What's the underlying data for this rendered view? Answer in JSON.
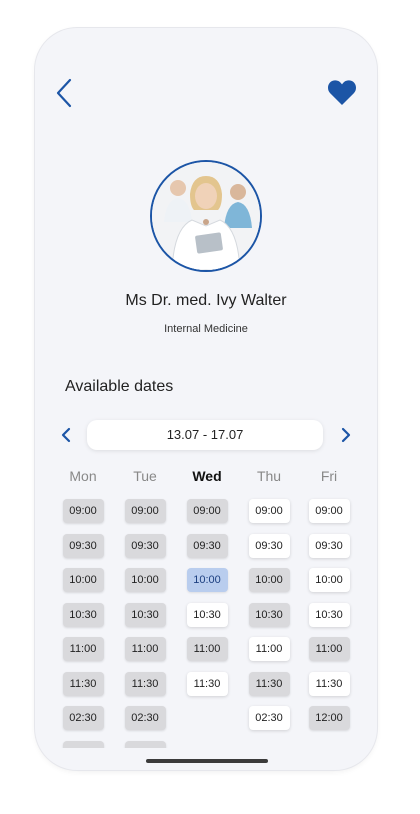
{
  "header": {
    "back_icon": "chevron-left-icon",
    "favorite_icon": "heart-icon",
    "accent_color": "#1c55a6"
  },
  "doctor": {
    "name": "Ms Dr. med. Ivy Walter",
    "specialty": "Internal Medicine"
  },
  "schedule": {
    "title": "Available dates",
    "week_range": "13.07 - 17.07",
    "prev_icon": "chevron-left-icon",
    "next_icon": "chevron-right-icon",
    "days": [
      {
        "label": "Mon",
        "active": false,
        "slots": [
          {
            "time": "09:00",
            "state": "unavailable"
          },
          {
            "time": "09:30",
            "state": "unavailable"
          },
          {
            "time": "10:00",
            "state": "unavailable"
          },
          {
            "time": "10:30",
            "state": "unavailable"
          },
          {
            "time": "11:00",
            "state": "unavailable"
          },
          {
            "time": "11:30",
            "state": "unavailable"
          },
          {
            "time": "02:30",
            "state": "unavailable"
          }
        ]
      },
      {
        "label": "Tue",
        "active": false,
        "slots": [
          {
            "time": "09:00",
            "state": "unavailable"
          },
          {
            "time": "09:30",
            "state": "unavailable"
          },
          {
            "time": "10:00",
            "state": "unavailable"
          },
          {
            "time": "10:30",
            "state": "unavailable"
          },
          {
            "time": "11:00",
            "state": "unavailable"
          },
          {
            "time": "11:30",
            "state": "unavailable"
          },
          {
            "time": "02:30",
            "state": "unavailable"
          }
        ]
      },
      {
        "label": "Wed",
        "active": true,
        "slots": [
          {
            "time": "09:00",
            "state": "unavailable"
          },
          {
            "time": "09:30",
            "state": "unavailable"
          },
          {
            "time": "10:00",
            "state": "selected"
          },
          {
            "time": "10:30",
            "state": "available"
          },
          {
            "time": "11:00",
            "state": "unavailable"
          },
          {
            "time": "11:30",
            "state": "available"
          }
        ]
      },
      {
        "label": "Thu",
        "active": false,
        "slots": [
          {
            "time": "09:00",
            "state": "available"
          },
          {
            "time": "09:30",
            "state": "available"
          },
          {
            "time": "10:00",
            "state": "unavailable"
          },
          {
            "time": "10:30",
            "state": "unavailable"
          },
          {
            "time": "11:00",
            "state": "available"
          },
          {
            "time": "11:30",
            "state": "unavailable"
          },
          {
            "time": "02:30",
            "state": "available"
          }
        ]
      },
      {
        "label": "Fri",
        "active": false,
        "slots": [
          {
            "time": "09:00",
            "state": "available"
          },
          {
            "time": "09:30",
            "state": "available"
          },
          {
            "time": "10:00",
            "state": "available"
          },
          {
            "time": "10:30",
            "state": "available"
          },
          {
            "time": "11:00",
            "state": "unavailable"
          },
          {
            "time": "11:30",
            "state": "available"
          },
          {
            "time": "12:00",
            "state": "unavailable"
          }
        ]
      }
    ]
  }
}
